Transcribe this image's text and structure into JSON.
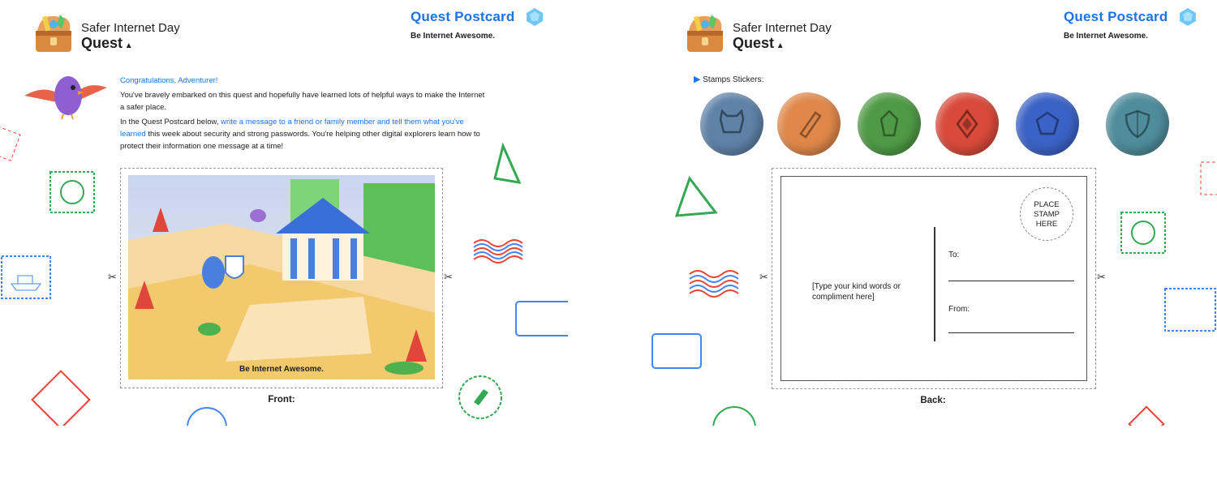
{
  "header": {
    "title_line1": "Safer Internet Day",
    "title_line2": "Quest",
    "postcard_title": "Quest Postcard",
    "tagline": "Be Internet Awesome."
  },
  "front_page": {
    "greeting": "Congratulations, Adventurer!",
    "paragraph1": "You've bravely embarked on this quest and hopefully have learned lots of helpful ways to make the Internet a safer place.",
    "paragraph2_start": "In the Quest Postcard below, ",
    "paragraph2_link": "write a message to a friend or family member and tell them what you've learned",
    "paragraph2_end": " this week about security and strong passwords. You're helping other digital explorers learn how to protect their information one message at a time!",
    "image_caption": "Be Internet Awesome.",
    "label": "Front:"
  },
  "back_page": {
    "stickers_label": "Stamps Stickers:",
    "stickers": [
      {
        "icon": "cat-mask-icon",
        "color": "#5f82a8"
      },
      {
        "icon": "pencil-icon",
        "color": "#e0884a"
      },
      {
        "icon": "crystal-icon",
        "color": "#4f9a46"
      },
      {
        "icon": "diamond-icon",
        "color": "#d94a3a"
      },
      {
        "icon": "gem-icon",
        "color": "#3b62c6"
      },
      {
        "icon": "shield-icon",
        "color": "#4f8c9c"
      }
    ],
    "message_placeholder": "[Type your kind words or compliment here]",
    "stamp_line1": "PLACE",
    "stamp_line2": "STAMP",
    "stamp_line3": "HERE",
    "to_label": "To:",
    "from_label": "From:",
    "label": "Back:"
  },
  "colors": {
    "accent": "#1a73e8",
    "red": "#ea4335",
    "green": "#34a853",
    "blue": "#4285f4"
  }
}
